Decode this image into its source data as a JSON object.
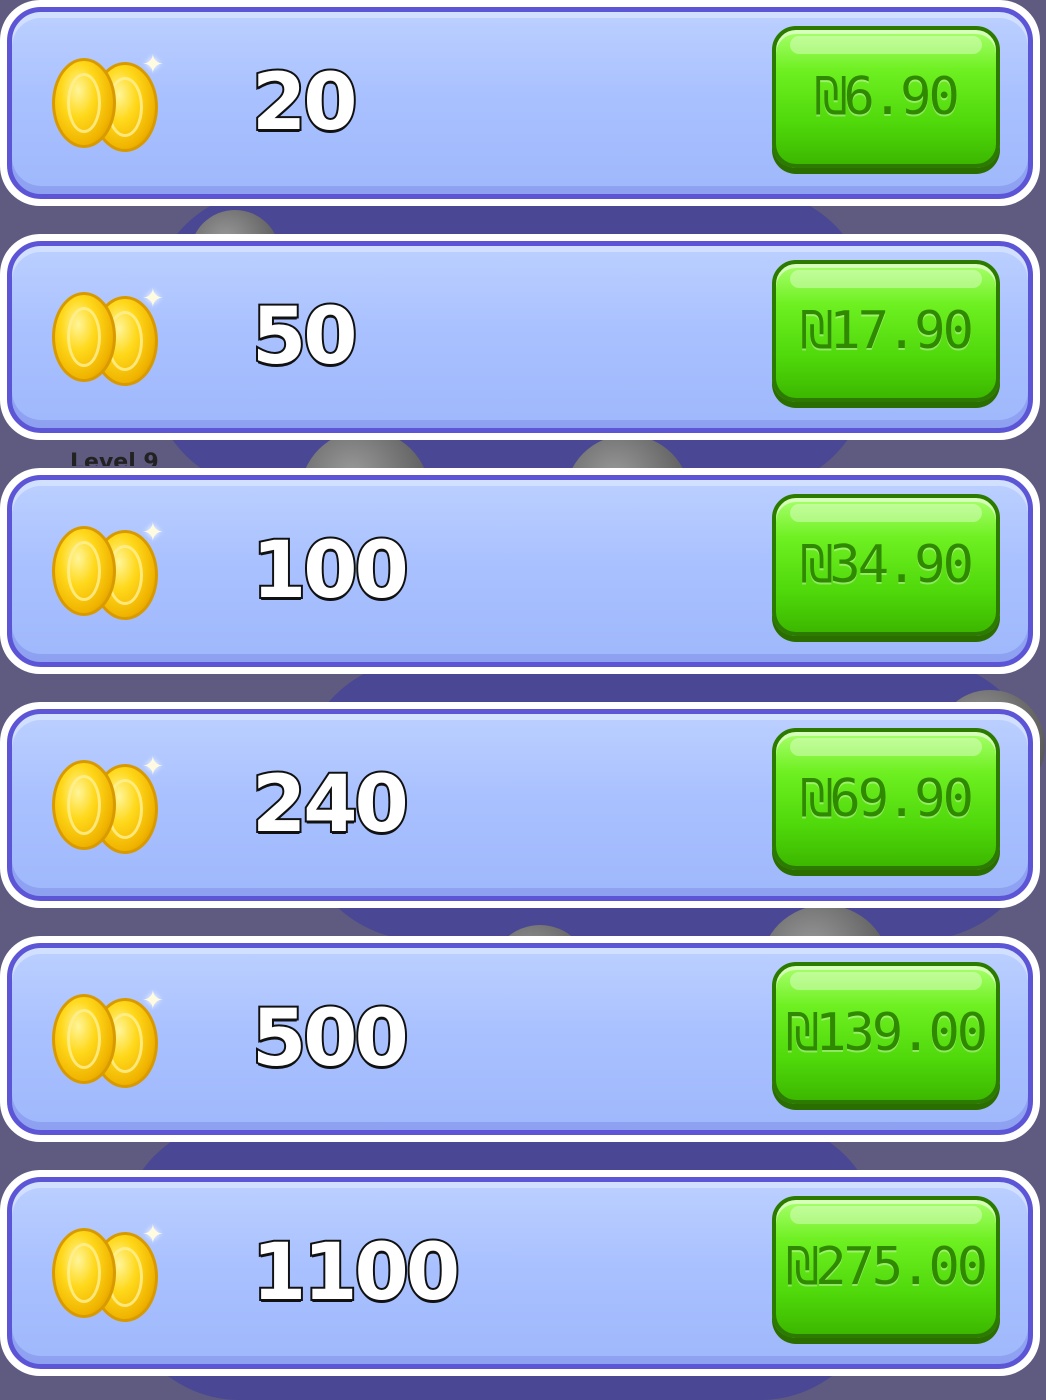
{
  "background": {
    "level_label": "Level 9"
  },
  "packages": [
    {
      "amount": "20",
      "price": "₪6.90"
    },
    {
      "amount": "50",
      "price": "₪17.90"
    },
    {
      "amount": "100",
      "price": "₪34.90"
    },
    {
      "amount": "240",
      "price": "₪69.90"
    },
    {
      "amount": "500",
      "price": "₪139.00"
    },
    {
      "amount": "1100",
      "price": "₪275.00"
    }
  ],
  "icons": {
    "coin": "coin-stack-icon"
  },
  "colors": {
    "button": "#52dd0c",
    "row": "#a9c1ff",
    "row_border": "#5c55d6"
  }
}
